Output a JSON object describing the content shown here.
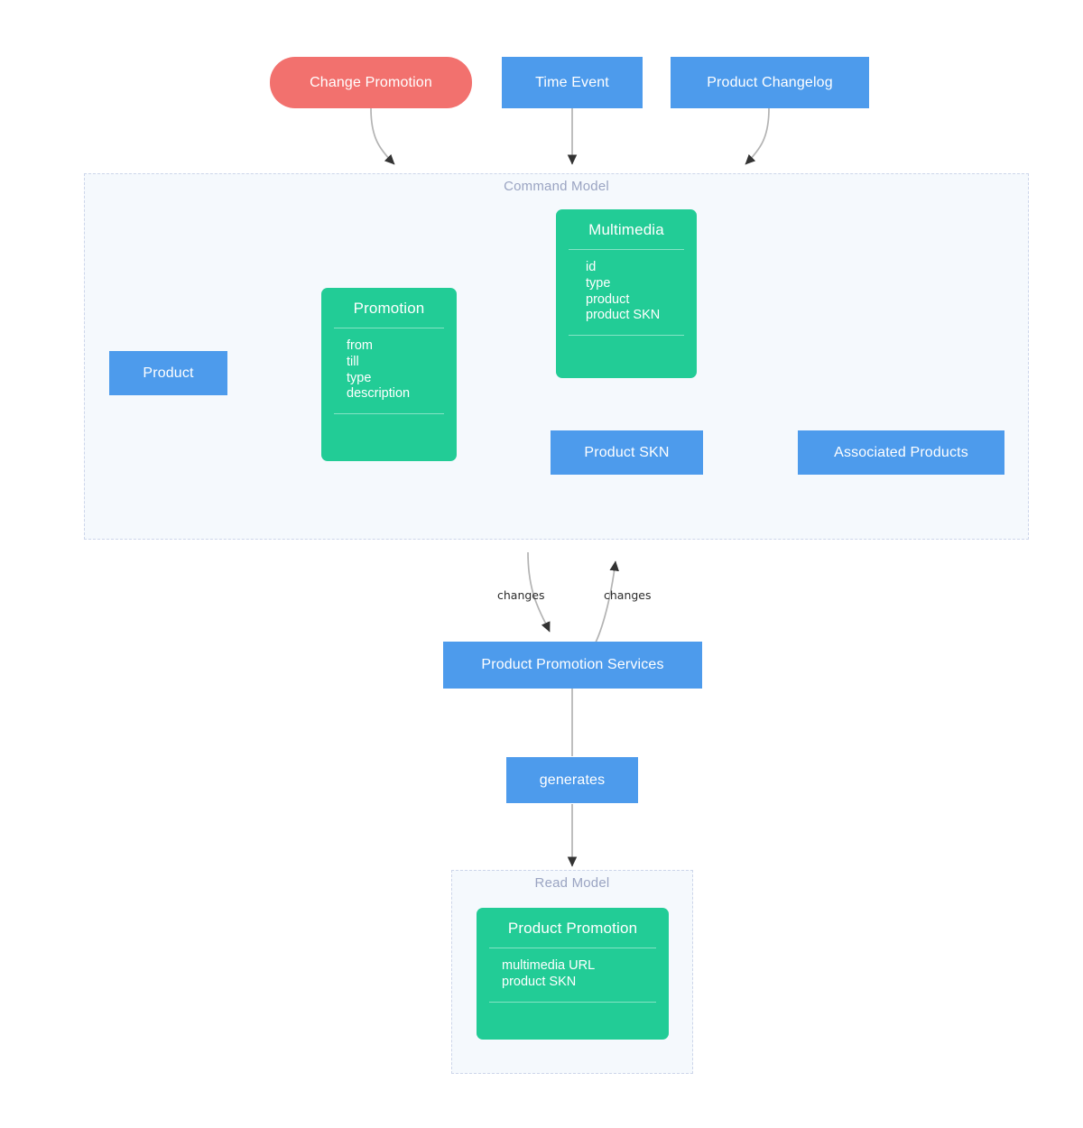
{
  "diagram": {
    "title_present": false,
    "colors": {
      "blue": "#4d9bec",
      "green": "#22cc96",
      "red": "#f2716e",
      "group_bg": "#f5f9fd",
      "group_border": "#cdd6ea",
      "group_label": "#9aa4c2",
      "edge": "#b3b3b3",
      "arrowhead": "#333333",
      "node_text": "#ffffff"
    }
  },
  "events": {
    "change_promotion": "Change Promotion",
    "time_event": "Time Event",
    "product_changelog": "Product Changelog"
  },
  "command_model": {
    "label": "Command Model",
    "product": "Product",
    "promotion": {
      "title": "Promotion",
      "attributes": [
        "from",
        "till",
        "type",
        "description"
      ]
    },
    "multimedia": {
      "title": "Multimedia",
      "attributes": [
        "id",
        "type",
        "product",
        "product SKN"
      ]
    },
    "product_skn": "Product SKN",
    "associated_products": "Associated Products"
  },
  "middle": {
    "changes_left": "changes",
    "changes_right": "changes",
    "services": "Product Promotion Services",
    "generates": "generates"
  },
  "read_model": {
    "label": "Read Model",
    "product_promotion": {
      "title": "Product Promotion",
      "attributes": [
        "multimedia URL",
        "product SKN"
      ]
    }
  }
}
